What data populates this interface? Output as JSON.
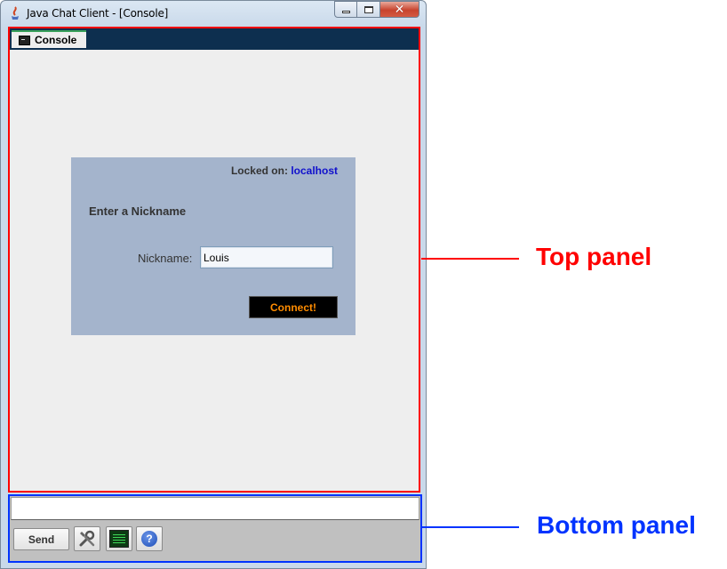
{
  "window": {
    "title": "Java Chat Client - [Console]"
  },
  "tabs": [
    {
      "label": "Console",
      "icon": "console-icon"
    }
  ],
  "login": {
    "locked_label": "Locked on:",
    "locked_host": "localhost",
    "heading": "Enter a Nickname",
    "nickname_label": "Nickname:",
    "nickname_value": "Louis",
    "connect_label": "Connect!"
  },
  "bottom": {
    "message_value": "",
    "send_label": "Send",
    "icons": [
      "tools-icon",
      "console-icon",
      "help-icon"
    ]
  },
  "annotations": {
    "top_panel": "Top panel",
    "bottom_panel": "Bottom panel"
  },
  "colors": {
    "top_panel_border": "#ff0000",
    "bottom_panel_border": "#0033ff",
    "tab_strip": "#0d2f4f",
    "login_card": "#a4b4cc",
    "connect_text": "#ff8c00",
    "host_link": "#1010cc"
  }
}
